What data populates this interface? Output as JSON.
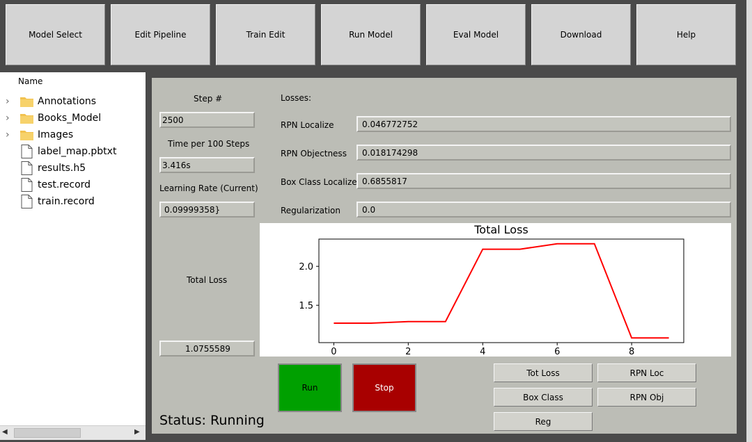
{
  "toolbar": {
    "buttons": [
      {
        "label": "Model Select"
      },
      {
        "label": "Edit Pipeline"
      },
      {
        "label": "Train Edit"
      },
      {
        "label": "Run Model"
      },
      {
        "label": "Eval Model"
      },
      {
        "label": "Download"
      },
      {
        "label": "Help"
      }
    ]
  },
  "tree": {
    "header": "Name",
    "items": [
      {
        "label": "Annotations",
        "type": "folder",
        "icon": "folder-icon"
      },
      {
        "label": "Books_Model",
        "type": "folder",
        "icon": "folder-icon"
      },
      {
        "label": "Images",
        "type": "folder",
        "icon": "folder-icon"
      },
      {
        "label": "label_map.pbtxt",
        "type": "file",
        "icon": "file-icon"
      },
      {
        "label": "results.h5",
        "type": "file",
        "icon": "file-icon"
      },
      {
        "label": "test.record",
        "type": "file",
        "icon": "file-icon"
      },
      {
        "label": "train.record",
        "type": "file",
        "icon": "file-icon"
      }
    ],
    "scroll_left": "◀",
    "scroll_right": "▶",
    "chevron": "›"
  },
  "stats": {
    "step_label": "Step #",
    "step_value": "2500",
    "time_label": "Time per 100 Steps",
    "time_value": "3.416s",
    "lr_label": "Learning Rate (Current)",
    "lr_value": "0.09999358}",
    "total_loss_label": "Total Loss",
    "total_loss_value": "1.0755589"
  },
  "losses": {
    "header": "Losses:",
    "rows": [
      {
        "label": "RPN Localize",
        "value": "0.046772752"
      },
      {
        "label": "RPN Objectness",
        "value": "0.018174298"
      },
      {
        "label": "Box Class Localize",
        "value": "0.6855817"
      },
      {
        "label": "Regularization",
        "value": "0.0"
      }
    ]
  },
  "controls": {
    "run_label": "Run",
    "stop_label": "Stop",
    "run_color": "#00a000",
    "stop_color": "#a80000"
  },
  "plot_buttons": {
    "tot_loss": "Tot Loss",
    "rpn_loc": "RPN Loc",
    "box_class": "Box Class",
    "rpn_obj": "RPN Obj",
    "reg": "Reg"
  },
  "status": {
    "text": "Status: Running"
  },
  "chart_data": {
    "type": "line",
    "title": "Total Loss",
    "xlabel": "",
    "ylabel": "",
    "x": [
      0,
      1,
      2,
      3,
      4,
      5,
      6,
      7,
      8,
      9
    ],
    "series": [
      {
        "values": [
          1.27,
          1.27,
          1.29,
          1.29,
          2.22,
          2.22,
          2.29,
          2.29,
          1.08,
          1.08
        ],
        "color": "#ff0000"
      }
    ],
    "xticks": [
      "0",
      "2",
      "4",
      "6",
      "8"
    ],
    "yticks": [
      "1.5",
      "2.0"
    ],
    "xlim": [
      -0.4,
      9.4
    ],
    "ylim": [
      1.02,
      2.35
    ],
    "grid": false
  }
}
